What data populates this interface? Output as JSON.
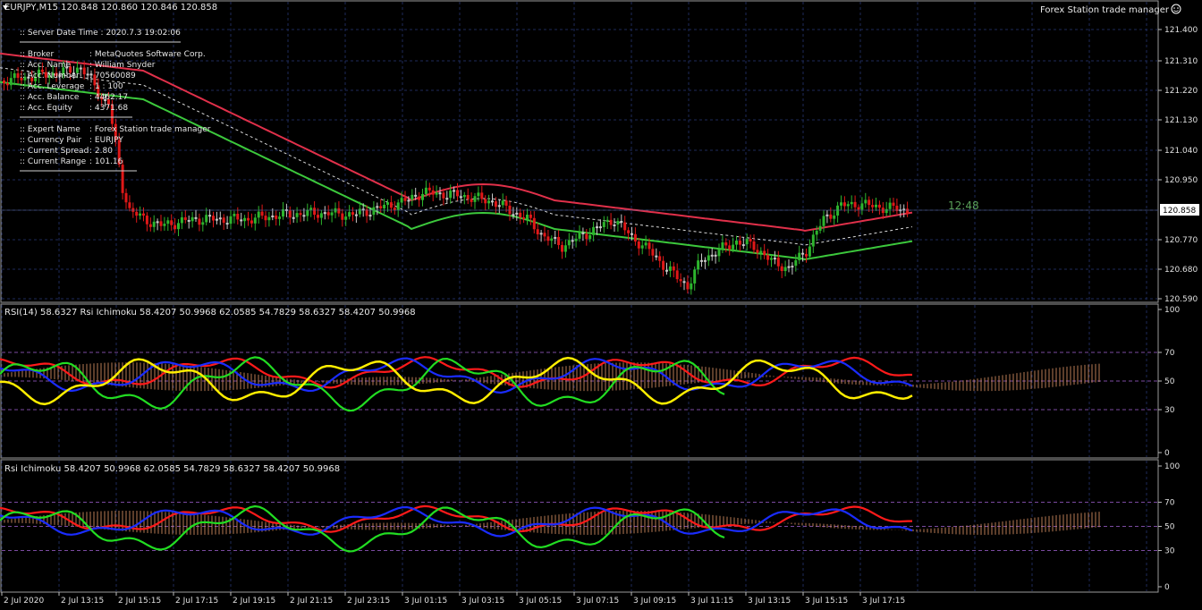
{
  "header": {
    "symbol_line": "EURJPY,M15  120.848 120.860 120.846 120.858",
    "ea_label": "Forex Station trade manager",
    "ea_icon": "smiley-icon"
  },
  "info_panel": {
    "server_time": ":: Server Date Time : 2020.7.3   19:02:06",
    "rows_account": [
      {
        "k": ":: Broker",
        "v": ": MetaQuotes Software Corp."
      },
      {
        "k": ":: Acc. Name",
        "v": ": William Snyder"
      },
      {
        "k": ":: Acc. Number",
        "v": ": 70560089"
      },
      {
        "k": ":: Acc. Leverage",
        "v": ": 1 : 100"
      },
      {
        "k": ":: Acc. Balance",
        "v": ": 4462.17"
      },
      {
        "k": ":: Acc. Equity",
        "v": ": 4371.68"
      }
    ],
    "rows_expert": [
      {
        "k": ":: Expert Name",
        "v": ": Forex Station trade manager"
      },
      {
        "k": ":: Currency Pair",
        "v": ": EURJPY"
      },
      {
        "k": ":: Current Spread",
        "v": ": 2.80"
      },
      {
        "k": ":: Current Range",
        "v": ": 101.16"
      }
    ]
  },
  "countdown": "12:48",
  "current_price_label": "120.858",
  "colors": {
    "background": "#000000",
    "grid": "#1e2a5a",
    "bull": "#2db52d",
    "bear": "#e01818",
    "doji": "#c8c8c8",
    "band_red": "#e0304a",
    "band_green": "#3cc83c",
    "rsi_yellow": "#ffee00",
    "rsi_blue": "#1a2cff",
    "rsi_red": "#ff1a1a",
    "rsi_green": "#22dd22",
    "cloud": "#e89a6a",
    "countdown": "#5aa05a"
  },
  "price_axis": [
    "121.400",
    "121.310",
    "121.220",
    "121.130",
    "121.040",
    "120.950",
    "120.858",
    "120.770",
    "120.680",
    "120.590"
  ],
  "rsi_axis": [
    "100",
    "70",
    "50",
    "30",
    "0"
  ],
  "panels": {
    "rsi_title": "RSI(14) 58.6327   Rsi Ichimoku 58.4207 50.9968 62.0585 54.7829 58.6327 58.4207 50.9968",
    "ichi_title": "Rsi Ichimoku 58.4207 50.9968 62.0585 54.7829 58.6327 58.4207 50.9968"
  },
  "time_axis": [
    "2 Jul 2020",
    "2 Jul 13:15",
    "2 Jul 15:15",
    "2 Jul 17:15",
    "2 Jul 19:15",
    "2 Jul 21:15",
    "2 Jul 23:15",
    "3 Jul 01:15",
    "3 Jul 03:15",
    "3 Jul 05:15",
    "3 Jul 07:15",
    "3 Jul 09:15",
    "3 Jul 11:15",
    "3 Jul 13:15",
    "3 Jul 15:15",
    "3 Jul 17:15"
  ]
}
